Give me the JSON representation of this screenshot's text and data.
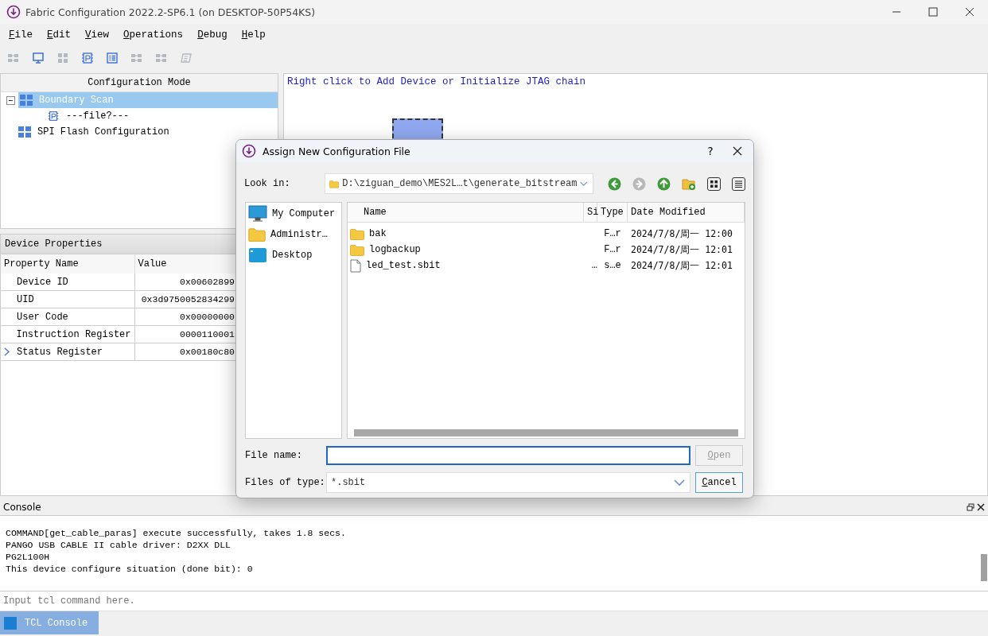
{
  "window": {
    "title": "Fabric Configuration 2022.2-SP6.1 (on DESKTOP-50P54KS)"
  },
  "menu": [
    "File",
    "Edit",
    "View",
    "Operations",
    "Debug",
    "Help"
  ],
  "toolbar": [
    {
      "kind": "chain",
      "disabled": true
    },
    {
      "kind": "monitor",
      "disabled": false
    },
    {
      "kind": "grid",
      "disabled": true
    },
    {
      "kind": "chip",
      "disabled": false
    },
    {
      "kind": "list",
      "disabled": false
    },
    {
      "kind": "chain",
      "disabled": true
    },
    {
      "kind": "chain",
      "disabled": true
    },
    {
      "kind": "eraser",
      "disabled": true
    }
  ],
  "config_tree": {
    "header": "Configuration Mode",
    "items": [
      {
        "label": "Boundary Scan",
        "kind": "scan",
        "selected": true,
        "expanded": true,
        "children": [
          {
            "label": "---file?---",
            "kind": "file",
            "selected": false
          }
        ]
      },
      {
        "label": "SPI Flash Configuration",
        "kind": "scan",
        "selected": false
      }
    ]
  },
  "device_properties": {
    "title": "Device Properties",
    "columns": [
      "Property Name",
      "Value"
    ],
    "rows": [
      {
        "name": "Device ID",
        "value": "0x00602899",
        "expandable": false
      },
      {
        "name": "UID",
        "value": "0x3d9750052834299",
        "expandable": false
      },
      {
        "name": "User Code",
        "value": "0x00000000",
        "expandable": false
      },
      {
        "name": "Instruction Register",
        "value": "0000110001",
        "expandable": false
      },
      {
        "name": "Status Register",
        "value": "0x00180c80",
        "expandable": true
      }
    ]
  },
  "canvas": {
    "hint": "Right click to Add Device or Initialize JTAG chain"
  },
  "dialog": {
    "title": "Assign New Configuration File",
    "help": "?",
    "look_in_label": "Look in:",
    "path": "D:\\ziguan_demo\\MES2L…t\\generate_bitstream",
    "places": [
      {
        "label": "My Computer",
        "kind": "computer"
      },
      {
        "label": "Administr…",
        "kind": "folder"
      },
      {
        "label": "Desktop",
        "kind": "desktop"
      }
    ],
    "columns": [
      "Name",
      "Si",
      "Type",
      "Date Modified"
    ],
    "files": [
      {
        "name": "bak",
        "kind": "folder",
        "type": "F…r",
        "date": "2024/7/8/周一 12:00"
      },
      {
        "name": "logbackup",
        "kind": "folder",
        "type": "F…r",
        "date": "2024/7/8/周一 12:01"
      },
      {
        "name": "led_test.sbit",
        "kind": "file",
        "size": "…",
        "type": "s…e",
        "date": "2024/7/8/周一 12:01"
      }
    ],
    "file_name_label": "File name:",
    "file_type_label": "Files of type:",
    "file_type": "*.sbit",
    "buttons": [
      {
        "label": "Open",
        "disabled": true
      },
      {
        "label": "Cancel",
        "disabled": false
      }
    ]
  },
  "console": {
    "title": "Console",
    "lines": [
      "COMMAND[get_cable_paras] execute successfully, takes 1.8 secs.",
      "PANGO USB CABLE II cable driver: D2XX DLL",
      "PG2L100H",
      "This device configure situation (done bit): 0"
    ],
    "input_placeholder": "Input tcl command here."
  },
  "bottom_tabs": [
    {
      "label": "TCL Console",
      "selected": true
    }
  ]
}
